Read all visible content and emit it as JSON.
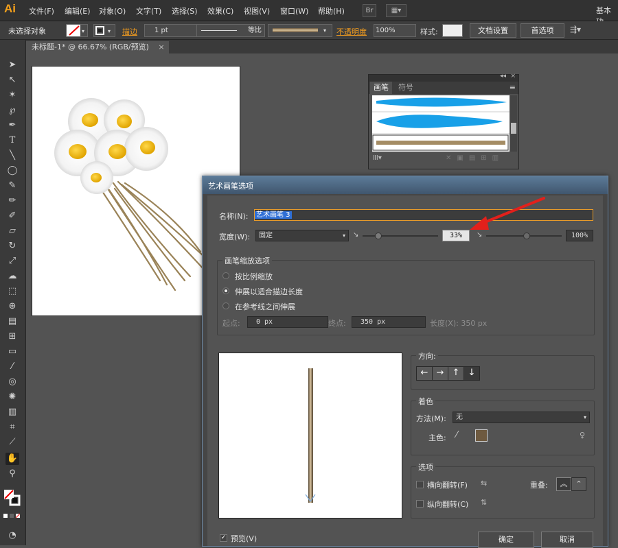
{
  "app": {
    "logo": "Ai",
    "workspace": "基本功"
  },
  "menu": [
    "文件(F)",
    "编辑(E)",
    "对象(O)",
    "文字(T)",
    "选择(S)",
    "效果(C)",
    "视图(V)",
    "窗口(W)",
    "帮助(H)"
  ],
  "menu_badges": {
    "bridge": "Br"
  },
  "control_bar": {
    "selection": "未选择对象",
    "stroke_label": "描边",
    "stroke_weight": "1 pt",
    "profile": "等比",
    "opacity_label": "不透明度",
    "opacity_value": "100%",
    "style_label": "样式:",
    "doc_setup": "文档设置",
    "preferences": "首选项"
  },
  "document": {
    "tab": "未标题-1* @ 66.67% (RGB/预览)"
  },
  "brush_panel": {
    "tabs": [
      "画笔",
      "符号"
    ]
  },
  "dialog": {
    "title": "艺术画笔选项",
    "name_label": "名称(N):",
    "name_value": "艺术画笔 3",
    "width_label": "宽度(W):",
    "width_mode": "固定",
    "width_value": "33%",
    "width_max": "100%",
    "scale_group_title": "画笔缩放选项",
    "scale_options": [
      "按比例缩放",
      "伸展以适合描边长度",
      "在参考线之间伸展"
    ],
    "selected_scale": 1,
    "start_label": "起点:",
    "start_value": "0 px",
    "end_label": "终点:",
    "end_value": "350 px",
    "length_text": "长度(X): 350 px",
    "direction_title": "方向:",
    "direction_buttons": [
      "←",
      "→",
      "↑",
      "↓"
    ],
    "color_title": "着色",
    "method_label": "方法(M):",
    "method_value": "无",
    "key_color_label": "主色:",
    "key_color": "#6e5a40",
    "options_title": "选项",
    "flip_along": "横向翻转(F)",
    "flip_across": "纵向翻转(C)",
    "overlap_label": "重叠:",
    "preview_label": "预览(V)",
    "ok": "确定",
    "cancel": "取消"
  }
}
